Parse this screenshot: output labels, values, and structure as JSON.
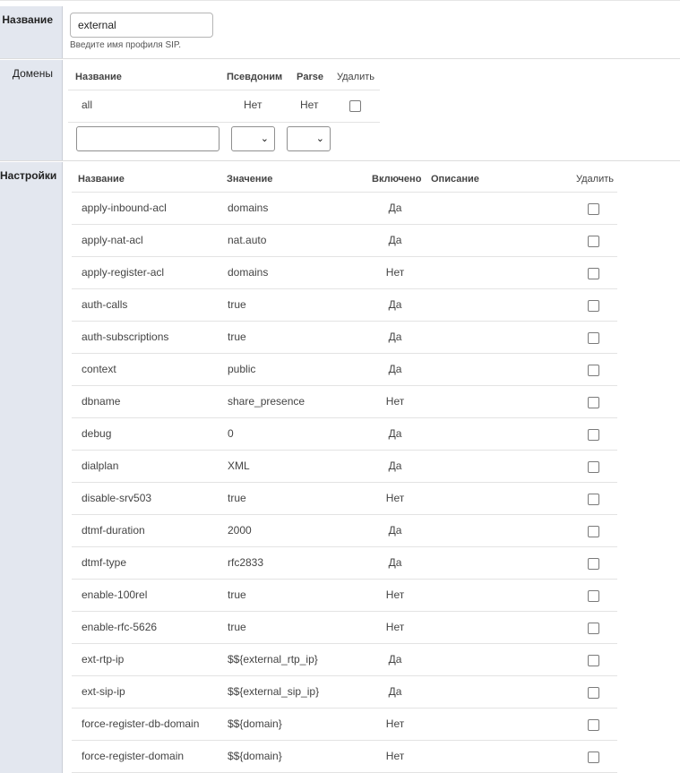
{
  "name_section": {
    "label": "Название",
    "value": "external",
    "hint": "Введите имя профиля SIP."
  },
  "domains_section": {
    "label": "Домены",
    "headers": {
      "name": "Название",
      "alias": "Псевдоним",
      "parse": "Parse",
      "delete": "Удалить"
    },
    "rows": [
      {
        "name": "all",
        "alias": "Нет",
        "parse": "Нет"
      }
    ]
  },
  "settings_section": {
    "label": "Настройки",
    "headers": {
      "name": "Название",
      "value": "Значение",
      "enabled": "Включено",
      "description": "Описание",
      "delete": "Удалить"
    },
    "rows": [
      {
        "name": "apply-inbound-acl",
        "value": "domains",
        "enabled": "Да"
      },
      {
        "name": "apply-nat-acl",
        "value": "nat.auto",
        "enabled": "Да"
      },
      {
        "name": "apply-register-acl",
        "value": "domains",
        "enabled": "Нет"
      },
      {
        "name": "auth-calls",
        "value": "true",
        "enabled": "Да"
      },
      {
        "name": "auth-subscriptions",
        "value": "true",
        "enabled": "Да"
      },
      {
        "name": "context",
        "value": "public",
        "enabled": "Да"
      },
      {
        "name": "dbname",
        "value": "share_presence",
        "enabled": "Нет"
      },
      {
        "name": "debug",
        "value": "0",
        "enabled": "Да"
      },
      {
        "name": "dialplan",
        "value": "XML",
        "enabled": "Да"
      },
      {
        "name": "disable-srv503",
        "value": "true",
        "enabled": "Нет"
      },
      {
        "name": "dtmf-duration",
        "value": "2000",
        "enabled": "Да"
      },
      {
        "name": "dtmf-type",
        "value": "rfc2833",
        "enabled": "Да"
      },
      {
        "name": "enable-100rel",
        "value": "true",
        "enabled": "Нет"
      },
      {
        "name": "enable-rfc-5626",
        "value": "true",
        "enabled": "Нет"
      },
      {
        "name": "ext-rtp-ip",
        "value": "$${external_rtp_ip}",
        "enabled": "Да"
      },
      {
        "name": "ext-sip-ip",
        "value": "$${external_sip_ip}",
        "enabled": "Да"
      },
      {
        "name": "force-register-db-domain",
        "value": "$${domain}",
        "enabled": "Нет"
      },
      {
        "name": "force-register-domain",
        "value": "$${domain}",
        "enabled": "Нет"
      }
    ]
  }
}
